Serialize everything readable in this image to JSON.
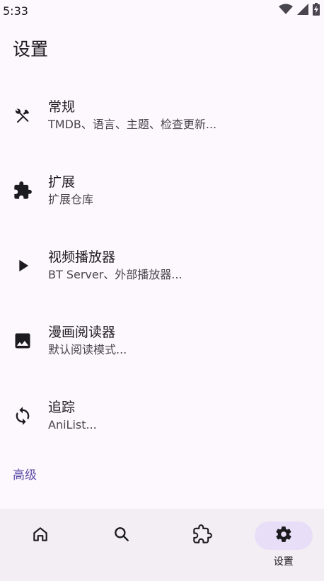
{
  "status_bar": {
    "time": "5:33",
    "icons": [
      "wifi-icon",
      "signal-icon",
      "battery-icon"
    ]
  },
  "page": {
    "title": "设置"
  },
  "settings": [
    {
      "icon": "build-tools-icon",
      "title": "常规",
      "subtitle": "TMDB、语言、主题、检查更新..."
    },
    {
      "icon": "extension-icon",
      "title": "扩展",
      "subtitle": "扩展仓库"
    },
    {
      "icon": "play-icon",
      "title": "视频播放器",
      "subtitle": "BT Server、外部播放器..."
    },
    {
      "icon": "image-icon",
      "title": "漫画阅读器",
      "subtitle": "默认阅读模式..."
    },
    {
      "icon": "sync-icon",
      "title": "追踪",
      "subtitle": "AniList..."
    }
  ],
  "section": {
    "advanced_label": "高级"
  },
  "bottom_nav": {
    "items": [
      {
        "icon": "home-icon",
        "label": ""
      },
      {
        "icon": "search-icon",
        "label": ""
      },
      {
        "icon": "extension-icon",
        "label": ""
      },
      {
        "icon": "settings-icon",
        "label": "设置",
        "active": true
      }
    ]
  },
  "colors": {
    "background": "#fdf8fd",
    "accent": "#5b4da6",
    "nav_background": "#f2eef4",
    "nav_active_pill": "#e8def8",
    "icon": "#49454f"
  }
}
